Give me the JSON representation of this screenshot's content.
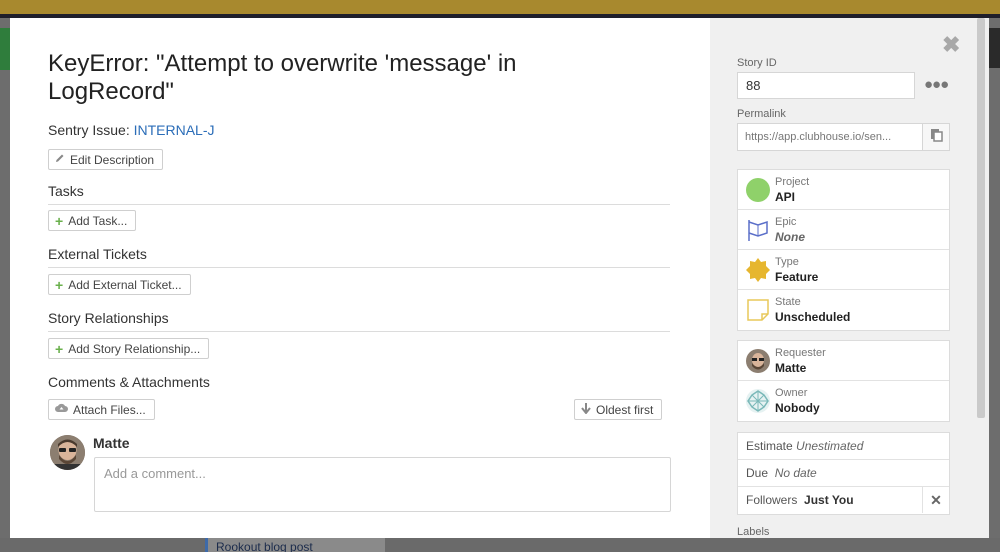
{
  "story": {
    "title": "KeyError: \"Attempt to overwrite 'message' in LogRecord\"",
    "sentry_label": "Sentry Issue:",
    "sentry_link": "INTERNAL-J",
    "edit_description": "Edit Description"
  },
  "sections": {
    "tasks": {
      "heading": "Tasks",
      "button": "Add Task..."
    },
    "external": {
      "heading": "External Tickets",
      "button": "Add External Ticket..."
    },
    "relationships": {
      "heading": "Story Relationships",
      "button": "Add Story Relationship..."
    },
    "comments": {
      "heading": "Comments & Attachments",
      "attach_button": "Attach Files...",
      "sort_button": "Oldest first",
      "author": "Matte",
      "placeholder": "Add a comment..."
    }
  },
  "sidebar": {
    "story_id_label": "Story ID",
    "story_id_value": "88",
    "permalink_label": "Permalink",
    "permalink_value": "https://app.clubhouse.io/sen...",
    "fields": [
      {
        "key": "Project",
        "value": "API",
        "icon": "project-dot-icon",
        "color": "#8fd16a"
      },
      {
        "key": "Epic",
        "value": "None",
        "icon": "flag-icon",
        "color": "#5b6fc9"
      },
      {
        "key": "Type",
        "value": "Feature",
        "icon": "feature-badge-icon",
        "color": "#e6b62f"
      },
      {
        "key": "State",
        "value": "Unscheduled",
        "icon": "note-icon",
        "color": "#e8c85a"
      }
    ],
    "people": [
      {
        "key": "Requester",
        "value": "Matte"
      },
      {
        "key": "Owner",
        "value": "Nobody"
      }
    ],
    "estimate_label": "Estimate",
    "estimate_value": "Unestimated",
    "due_label": "Due",
    "due_value": "No date",
    "followers_label": "Followers",
    "followers_value": "Just You",
    "labels_label": "Labels"
  },
  "background": {
    "card_text": "Rookout blog post"
  }
}
